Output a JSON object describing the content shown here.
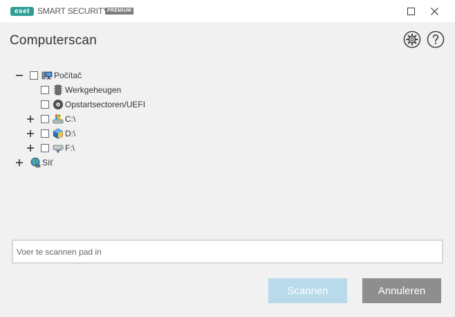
{
  "window": {
    "logo_text": "eset",
    "product_name": "SMART SECURITY",
    "edition": "PREMIUM"
  },
  "header": {
    "title": "Computerscan"
  },
  "tree": {
    "items": [
      {
        "label": "Počítač",
        "icon": "computer-icon",
        "expander": "collapse"
      },
      {
        "label": "Werkgeheugen",
        "icon": "memory-icon"
      },
      {
        "label": "Opstartsectoren/UEFI",
        "icon": "disc-icon"
      },
      {
        "label": "C:\\",
        "icon": "system-drive-icon",
        "expander": "expand"
      },
      {
        "label": "D:\\",
        "icon": "optical-drive-icon",
        "expander": "expand"
      },
      {
        "label": "F:\\",
        "icon": "removable-drive-icon",
        "expander": "expand"
      },
      {
        "label": "Síť",
        "icon": "network-globe-icon",
        "expander": "expand"
      }
    ]
  },
  "path_input": {
    "placeholder": "Voer te scannen pad in",
    "value": ""
  },
  "buttons": {
    "scan": "Scannen",
    "cancel": "Annuleren"
  },
  "colors": {
    "accent": "#2e9e96",
    "scan_button_disabled": "#b9daeb",
    "cancel_button": "#8e8e8e",
    "background": "#f1f1f1"
  }
}
